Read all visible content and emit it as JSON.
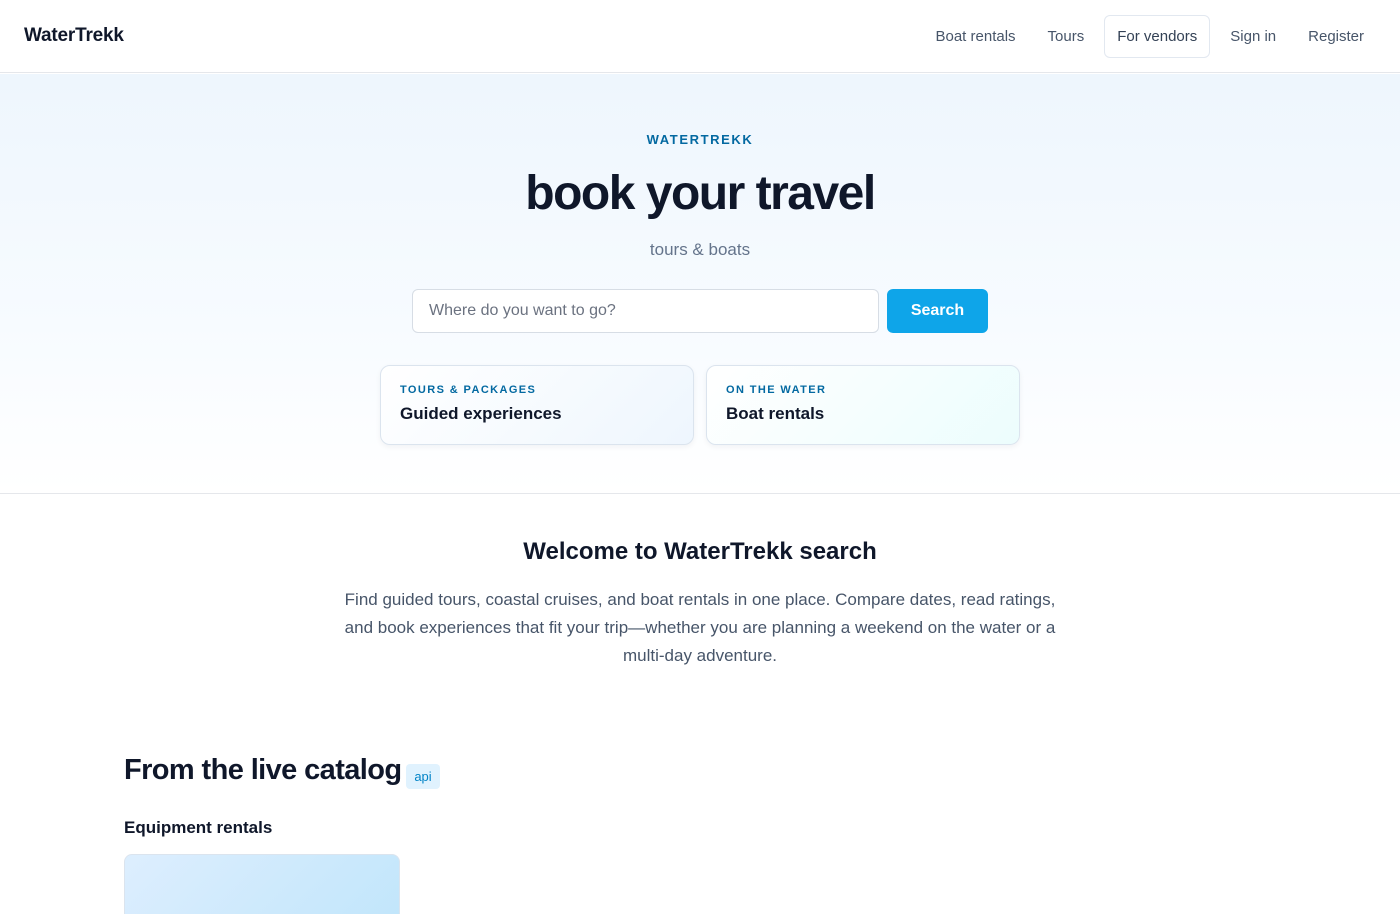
{
  "header": {
    "brand": "WaterTrekk",
    "nav": {
      "boat_rentals": "Boat rentals",
      "tours": "Tours",
      "for_vendors": "For vendors",
      "sign_in": "Sign in",
      "register": "Register"
    }
  },
  "hero": {
    "eyebrow": "WATERTREKK",
    "title": "book your travel",
    "subtitle": "tours & boats",
    "search": {
      "placeholder": "Where do you want to go?",
      "value": "",
      "button_label": "Search"
    },
    "categories": [
      {
        "kicker": "TOURS & PACKAGES",
        "title": "Guided experiences"
      },
      {
        "kicker": "ON THE WATER",
        "title": "Boat rentals"
      }
    ]
  },
  "welcome": {
    "title": "Welcome to WaterTrekk search",
    "text": "Find guided tours, coastal cruises, and boat rentals in one place. Compare dates, read ratings, and book experiences that fit your trip—whether you are planning a weekend on the water or a multi-day adventure."
  },
  "catalog": {
    "title": "From the live catalog",
    "badge": "api",
    "section_label": "Equipment rentals"
  },
  "colors": {
    "accent": "#0ea5e9",
    "accent_dark": "#0369a1",
    "text": "#0f172a",
    "muted": "#64748b",
    "badge_bg": "#e0f2fe"
  }
}
